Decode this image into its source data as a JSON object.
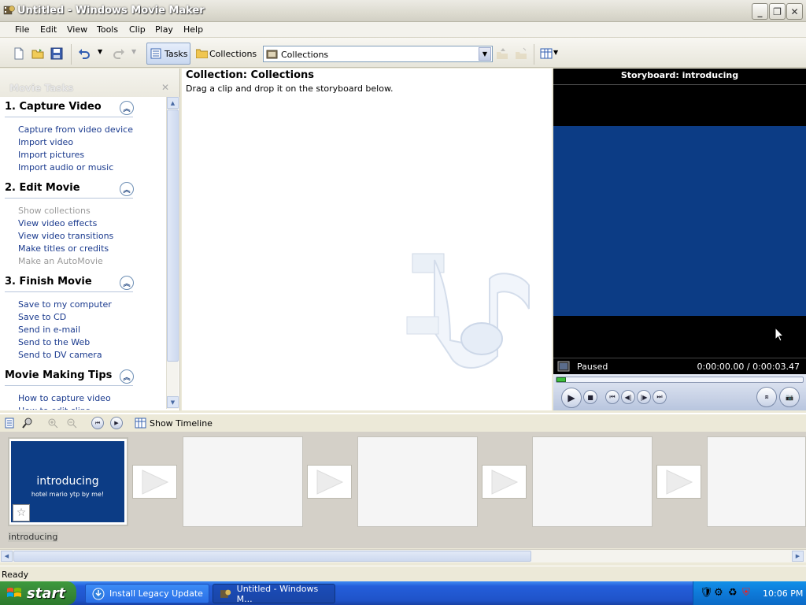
{
  "window": {
    "title": "Untitled - Windows Movie Maker"
  },
  "menu": [
    "File",
    "Edit",
    "View",
    "Tools",
    "Clip",
    "Play",
    "Help"
  ],
  "toolbar": {
    "tasks_label": "Tasks",
    "collections_label": "Collections",
    "combo_value": "Collections"
  },
  "tasks_panel": {
    "title": "Movie Tasks",
    "sections": [
      {
        "title": "1. Capture Video",
        "items": [
          {
            "label": "Capture from video device",
            "enabled": true
          },
          {
            "label": "Import video",
            "enabled": true
          },
          {
            "label": "Import pictures",
            "enabled": true
          },
          {
            "label": "Import audio or music",
            "enabled": true
          }
        ]
      },
      {
        "title": "2. Edit Movie",
        "items": [
          {
            "label": "Show collections",
            "enabled": false
          },
          {
            "label": "View video effects",
            "enabled": true
          },
          {
            "label": "View video transitions",
            "enabled": true
          },
          {
            "label": "Make titles or credits",
            "enabled": true
          },
          {
            "label": "Make an AutoMovie",
            "enabled": false
          }
        ]
      },
      {
        "title": "3. Finish Movie",
        "items": [
          {
            "label": "Save to my computer",
            "enabled": true
          },
          {
            "label": "Save to CD",
            "enabled": true
          },
          {
            "label": "Send in e-mail",
            "enabled": true
          },
          {
            "label": "Send to the Web",
            "enabled": true
          },
          {
            "label": "Send to DV camera",
            "enabled": true
          }
        ]
      },
      {
        "title": "Movie Making Tips",
        "items": [
          {
            "label": "How to capture video",
            "enabled": true
          },
          {
            "label": "How to edit clips",
            "enabled": true
          }
        ]
      }
    ]
  },
  "collection": {
    "title": "Collection: Collections",
    "subtitle": "Drag a clip and drop it on the storyboard below."
  },
  "preview": {
    "title": "Storyboard: introducing",
    "status": "Paused",
    "time": "0:00:00.00 / 0:00:03.47",
    "progress": 0.0
  },
  "storyboard": {
    "show_timeline_label": "Show Timeline",
    "clip": {
      "title": "introducing",
      "subtitle": "hotel mario ytp by me!",
      "caption": "introducing"
    }
  },
  "status": {
    "text": "Ready"
  },
  "taskbar": {
    "start_label": "start",
    "buttons": [
      "Install Legacy Update",
      "Untitled - Windows M..."
    ],
    "clock": "10:06 PM"
  },
  "colors": {
    "preview_blue": "#0c3c85",
    "task_link": "#1a3a8e",
    "xp_taskbar": "#245edb",
    "start_green": "#3a8e3a"
  }
}
